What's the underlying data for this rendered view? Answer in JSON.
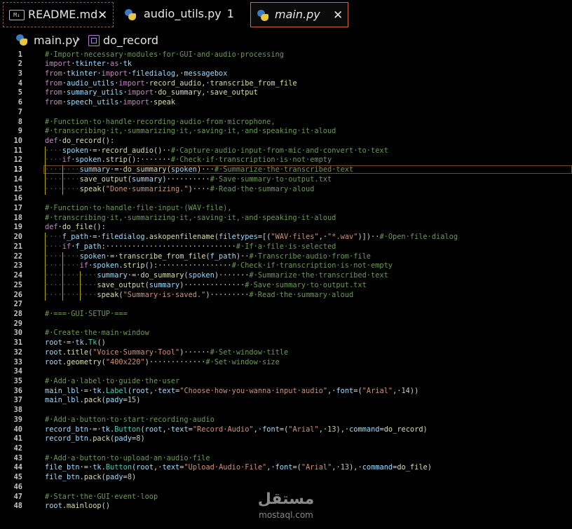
{
  "tabs": [
    {
      "label": "README.md",
      "icon": "markdown-icon",
      "icon_text": "M↓",
      "close": "✕"
    },
    {
      "label": "audio_utils.py",
      "badge": "1",
      "icon": "python-icon"
    },
    {
      "label": "main.py",
      "icon": "python-icon",
      "close": "✕",
      "active": true
    }
  ],
  "breadcrumb": {
    "file": "main.py",
    "separator": "›",
    "symbol": "do_record"
  },
  "active_line": 13,
  "lines": [
    {
      "n": "1",
      "i": 0,
      "t": [
        [
          "cm",
          "#·Import·necessary·modules·for·GUI·and·audio·processing"
        ]
      ]
    },
    {
      "n": "2",
      "i": 0,
      "t": [
        [
          "kw",
          "import"
        ],
        [
          "",
          "·"
        ],
        [
          "var",
          "tkinter"
        ],
        [
          "",
          "·"
        ],
        [
          "kw",
          "as"
        ],
        [
          "",
          "·"
        ],
        [
          "var",
          "tk"
        ]
      ]
    },
    {
      "n": "3",
      "i": 0,
      "t": [
        [
          "kw",
          "from"
        ],
        [
          "",
          "·"
        ],
        [
          "var",
          "tkinter"
        ],
        [
          "",
          "·"
        ],
        [
          "kw",
          "import"
        ],
        [
          "",
          "·"
        ],
        [
          "var",
          "filedialog"
        ],
        [
          "",
          ",·"
        ],
        [
          "var",
          "messagebox"
        ]
      ]
    },
    {
      "n": "4",
      "i": 0,
      "t": [
        [
          "kw",
          "from"
        ],
        [
          "",
          "·"
        ],
        [
          "var",
          "audio_utils"
        ],
        [
          "",
          "·"
        ],
        [
          "kw",
          "import"
        ],
        [
          "",
          "·"
        ],
        [
          "fn",
          "record_audio"
        ],
        [
          "",
          ",·"
        ],
        [
          "fn",
          "transcribe_from_file"
        ]
      ]
    },
    {
      "n": "5",
      "i": 0,
      "t": [
        [
          "kw",
          "from"
        ],
        [
          "",
          "·"
        ],
        [
          "var",
          "summary_utils"
        ],
        [
          "",
          "·"
        ],
        [
          "kw",
          "import"
        ],
        [
          "",
          "·"
        ],
        [
          "fn",
          "do_summary"
        ],
        [
          "",
          ",·"
        ],
        [
          "fn",
          "save_output"
        ]
      ]
    },
    {
      "n": "6",
      "i": 0,
      "t": [
        [
          "kw",
          "from"
        ],
        [
          "",
          "·"
        ],
        [
          "var",
          "speech_utils"
        ],
        [
          "",
          "·"
        ],
        [
          "kw",
          "import"
        ],
        [
          "",
          "·"
        ],
        [
          "fn",
          "speak"
        ]
      ]
    },
    {
      "n": "7",
      "i": 0,
      "t": []
    },
    {
      "n": "8",
      "i": 0,
      "t": [
        [
          "cm",
          "#·Function·to·handle·recording·audio·from·microphone,"
        ]
      ]
    },
    {
      "n": "9",
      "i": 0,
      "t": [
        [
          "cm",
          "#·transcribing·it,·summarizing·it,·saving·it,·and·speaking·it·aloud"
        ]
      ]
    },
    {
      "n": "10",
      "i": 0,
      "t": [
        [
          "kw",
          "def"
        ],
        [
          "",
          "·"
        ],
        [
          "fn",
          "do_record"
        ],
        [
          "",
          "():"
        ]
      ]
    },
    {
      "n": "11",
      "i": 1,
      "t": [
        [
          "var",
          "spoken"
        ],
        [
          "",
          "·=·"
        ],
        [
          "fn",
          "record_audio"
        ],
        [
          "",
          "()··"
        ],
        [
          "cm",
          "#·Capture·audio·input·from·mic·and·convert·to·text"
        ]
      ]
    },
    {
      "n": "12",
      "i": 1,
      "t": [
        [
          "kw",
          "if"
        ],
        [
          "",
          "·"
        ],
        [
          "var",
          "spoken"
        ],
        [
          "",
          "."
        ],
        [
          "fn",
          "strip"
        ],
        [
          "",
          "():·······"
        ],
        [
          "cm",
          "#·Check·if·transcription·is·not·empty"
        ]
      ]
    },
    {
      "n": "13",
      "i": 2,
      "t": [
        [
          "var",
          "summary"
        ],
        [
          "",
          "·=·"
        ],
        [
          "fn",
          "do_summary"
        ],
        [
          "",
          "("
        ],
        [
          "var",
          "spoken"
        ],
        [
          "",
          ")···"
        ],
        [
          "cm",
          "#·Summarize·the·transcribed·text"
        ]
      ]
    },
    {
      "n": "14",
      "i": 2,
      "t": [
        [
          "fn",
          "save_output"
        ],
        [
          "",
          "("
        ],
        [
          "var",
          "summary"
        ],
        [
          "",
          ")··········"
        ],
        [
          "cm",
          "#·Save·summary·to·output.txt"
        ]
      ]
    },
    {
      "n": "15",
      "i": 2,
      "t": [
        [
          "fn",
          "speak"
        ],
        [
          "",
          "("
        ],
        [
          "str",
          "\"Done·summarizing.\""
        ],
        [
          "",
          ")····"
        ],
        [
          "cm",
          "#·Read·the·summary·aloud"
        ]
      ]
    },
    {
      "n": "16",
      "i": 0,
      "t": []
    },
    {
      "n": "17",
      "i": 0,
      "t": [
        [
          "cm",
          "#·Function·to·handle·file·input·(WAV·file),"
        ]
      ]
    },
    {
      "n": "18",
      "i": 0,
      "t": [
        [
          "cm",
          "#·transcribing·it,·summarizing·it,·saving·it,·and·speaking·it·aloud"
        ]
      ]
    },
    {
      "n": "19",
      "i": 0,
      "t": [
        [
          "kw",
          "def"
        ],
        [
          "",
          "·"
        ],
        [
          "fn",
          "do_file"
        ],
        [
          "",
          "():"
        ]
      ]
    },
    {
      "n": "20",
      "i": 1,
      "t": [
        [
          "var",
          "f_path"
        ],
        [
          "",
          "·=·"
        ],
        [
          "var",
          "filedialog"
        ],
        [
          "",
          "."
        ],
        [
          "fn",
          "askopenfilename"
        ],
        [
          "",
          "("
        ],
        [
          "var",
          "filetypes"
        ],
        [
          "",
          "=[("
        ],
        [
          "str",
          "\"WAV·files\""
        ],
        [
          "",
          ",·"
        ],
        [
          "str",
          "\"*.wav\""
        ],
        [
          "",
          ")])··"
        ],
        [
          "cm",
          "#·Open·file·dialog"
        ]
      ]
    },
    {
      "n": "21",
      "i": 1,
      "t": [
        [
          "kw",
          "if"
        ],
        [
          "",
          "·"
        ],
        [
          "var",
          "f_path"
        ],
        [
          "",
          ":······························"
        ],
        [
          "cm",
          "#·If·a·file·is·selected"
        ]
      ]
    },
    {
      "n": "22",
      "i": 2,
      "t": [
        [
          "var",
          "spoken"
        ],
        [
          "",
          "·=·"
        ],
        [
          "fn",
          "transcribe_from_file"
        ],
        [
          "",
          "("
        ],
        [
          "var",
          "f_path"
        ],
        [
          "",
          ")··"
        ],
        [
          "cm",
          "#·Transcribe·audio·from·file"
        ]
      ]
    },
    {
      "n": "23",
      "i": 2,
      "t": [
        [
          "kw",
          "if"
        ],
        [
          "",
          "·"
        ],
        [
          "var",
          "spoken"
        ],
        [
          "",
          "."
        ],
        [
          "fn",
          "strip"
        ],
        [
          "",
          "():·················"
        ],
        [
          "cm",
          "#·Check·if·transcription·is·not·empty"
        ]
      ]
    },
    {
      "n": "24",
      "i": 3,
      "t": [
        [
          "var",
          "summary"
        ],
        [
          "",
          "·=·"
        ],
        [
          "fn",
          "do_summary"
        ],
        [
          "",
          "("
        ],
        [
          "var",
          "spoken"
        ],
        [
          "",
          ")·······"
        ],
        [
          "cm",
          "#·Summarize·the·transcribed·text"
        ]
      ]
    },
    {
      "n": "25",
      "i": 3,
      "t": [
        [
          "fn",
          "save_output"
        ],
        [
          "",
          "("
        ],
        [
          "var",
          "summary"
        ],
        [
          "",
          ")··············"
        ],
        [
          "cm",
          "#·Save·summary·to·output.txt"
        ]
      ]
    },
    {
      "n": "26",
      "i": 3,
      "t": [
        [
          "fn",
          "speak"
        ],
        [
          "",
          "("
        ],
        [
          "str",
          "\"Summary·is·saved.\""
        ],
        [
          "",
          ")·········"
        ],
        [
          "cm",
          "#·Read·the·summary·aloud"
        ]
      ]
    },
    {
      "n": "27",
      "i": 0,
      "t": []
    },
    {
      "n": "28",
      "i": 0,
      "t": [
        [
          "cm",
          "#·===·GUI·SETUP·==="
        ]
      ]
    },
    {
      "n": "29",
      "i": 0,
      "t": []
    },
    {
      "n": "30",
      "i": 0,
      "t": [
        [
          "cm",
          "#·Create·the·main·window"
        ]
      ]
    },
    {
      "n": "31",
      "i": 0,
      "t": [
        [
          "var",
          "root"
        ],
        [
          "",
          "·=·"
        ],
        [
          "var",
          "tk"
        ],
        [
          "",
          "."
        ],
        [
          "cls",
          "Tk"
        ],
        [
          "",
          "()"
        ]
      ]
    },
    {
      "n": "32",
      "i": 0,
      "t": [
        [
          "var",
          "root"
        ],
        [
          "",
          "."
        ],
        [
          "fn",
          "title"
        ],
        [
          "",
          "("
        ],
        [
          "str",
          "\"Voice·Summary·Tool\""
        ],
        [
          "",
          ")······"
        ],
        [
          "cm",
          "#·Set·window·title"
        ]
      ]
    },
    {
      "n": "33",
      "i": 0,
      "t": [
        [
          "var",
          "root"
        ],
        [
          "",
          "."
        ],
        [
          "fn",
          "geometry"
        ],
        [
          "",
          "("
        ],
        [
          "str",
          "\"400x220\""
        ],
        [
          "",
          ")·············"
        ],
        [
          "cm",
          "#·Set·window·size"
        ]
      ]
    },
    {
      "n": "34",
      "i": 0,
      "t": []
    },
    {
      "n": "35",
      "i": 0,
      "t": [
        [
          "cm",
          "#·Add·a·label·to·guide·the·user"
        ]
      ]
    },
    {
      "n": "36",
      "i": 0,
      "t": [
        [
          "var",
          "main_lbl"
        ],
        [
          "",
          "·=·"
        ],
        [
          "var",
          "tk"
        ],
        [
          "",
          "."
        ],
        [
          "cls",
          "Label"
        ],
        [
          "",
          "("
        ],
        [
          "var",
          "root"
        ],
        [
          "",
          ",·"
        ],
        [
          "var",
          "text"
        ],
        [
          "",
          "="
        ],
        [
          "str",
          "\"Choose·how·you·wanna·input·audio\""
        ],
        [
          "",
          ",·"
        ],
        [
          "var",
          "font"
        ],
        [
          "",
          "=("
        ],
        [
          "str",
          "\"Arial\""
        ],
        [
          "",
          ",·"
        ],
        [
          "num",
          "14"
        ],
        [
          "",
          "))"
        ]
      ]
    },
    {
      "n": "37",
      "i": 0,
      "t": [
        [
          "var",
          "main_lbl"
        ],
        [
          "",
          "."
        ],
        [
          "fn",
          "pack"
        ],
        [
          "",
          "("
        ],
        [
          "var",
          "pady"
        ],
        [
          "",
          "="
        ],
        [
          "num",
          "15"
        ],
        [
          "",
          ")"
        ]
      ]
    },
    {
      "n": "38",
      "i": 0,
      "t": []
    },
    {
      "n": "39",
      "i": 0,
      "t": [
        [
          "cm",
          "#·Add·a·button·to·start·recording·audio"
        ]
      ]
    },
    {
      "n": "40",
      "i": 0,
      "t": [
        [
          "var",
          "record_btn"
        ],
        [
          "",
          "·=·"
        ],
        [
          "var",
          "tk"
        ],
        [
          "",
          "."
        ],
        [
          "cls",
          "Button"
        ],
        [
          "",
          "("
        ],
        [
          "var",
          "root"
        ],
        [
          "",
          ",·"
        ],
        [
          "var",
          "text"
        ],
        [
          "",
          "="
        ],
        [
          "str",
          "\"Record·Audio\""
        ],
        [
          "",
          ",·"
        ],
        [
          "var",
          "font"
        ],
        [
          "",
          "=("
        ],
        [
          "str",
          "\"Arial\""
        ],
        [
          "",
          ",·"
        ],
        [
          "num",
          "13"
        ],
        [
          "",
          "),·"
        ],
        [
          "var",
          "command"
        ],
        [
          "",
          "="
        ],
        [
          "fn",
          "do_record"
        ],
        [
          "",
          ")"
        ]
      ]
    },
    {
      "n": "41",
      "i": 0,
      "t": [
        [
          "var",
          "record_btn"
        ],
        [
          "",
          "."
        ],
        [
          "fn",
          "pack"
        ],
        [
          "",
          "("
        ],
        [
          "var",
          "pady"
        ],
        [
          "",
          "="
        ],
        [
          "num",
          "8"
        ],
        [
          "",
          ")"
        ]
      ]
    },
    {
      "n": "42",
      "i": 0,
      "t": []
    },
    {
      "n": "43",
      "i": 0,
      "t": [
        [
          "cm",
          "#·Add·a·button·to·upload·an·audio·file"
        ]
      ]
    },
    {
      "n": "44",
      "i": 0,
      "t": [
        [
          "var",
          "file_btn"
        ],
        [
          "",
          "·=·"
        ],
        [
          "var",
          "tk"
        ],
        [
          "",
          "."
        ],
        [
          "cls",
          "Button"
        ],
        [
          "",
          "("
        ],
        [
          "var",
          "root"
        ],
        [
          "",
          ",·"
        ],
        [
          "var",
          "text"
        ],
        [
          "",
          "="
        ],
        [
          "str",
          "\"Upload·Audio·File\""
        ],
        [
          "",
          ",·"
        ],
        [
          "var",
          "font"
        ],
        [
          "",
          "=("
        ],
        [
          "str",
          "\"Arial\""
        ],
        [
          "",
          ",·"
        ],
        [
          "num",
          "13"
        ],
        [
          "",
          "),·"
        ],
        [
          "var",
          "command"
        ],
        [
          "",
          "="
        ],
        [
          "fn",
          "do_file"
        ],
        [
          "",
          ")"
        ]
      ]
    },
    {
      "n": "45",
      "i": 0,
      "t": [
        [
          "var",
          "file_btn"
        ],
        [
          "",
          "."
        ],
        [
          "fn",
          "pack"
        ],
        [
          "",
          "("
        ],
        [
          "var",
          "pady"
        ],
        [
          "",
          "="
        ],
        [
          "num",
          "8"
        ],
        [
          "",
          ")"
        ]
      ]
    },
    {
      "n": "46",
      "i": 0,
      "t": []
    },
    {
      "n": "47",
      "i": 0,
      "t": [
        [
          "cm",
          "#·Start·the·GUI·event·loop"
        ]
      ]
    },
    {
      "n": "48",
      "i": 0,
      "t": [
        [
          "var",
          "root"
        ],
        [
          "",
          "."
        ],
        [
          "fn",
          "mainloop"
        ],
        [
          "",
          "()"
        ]
      ]
    }
  ],
  "watermark": {
    "arabic": "مستقل",
    "latin": "mostaql.com"
  },
  "colors": {
    "keyword": "#c586c0",
    "function": "#dcdcaa",
    "comment": "#6a9955",
    "string": "#ce9178",
    "variable": "#9cdcfe",
    "class": "#4ec9b0",
    "number": "#b5cea8",
    "indent_guide": "#b3a800",
    "active_tab_border": "#d06a3a"
  }
}
